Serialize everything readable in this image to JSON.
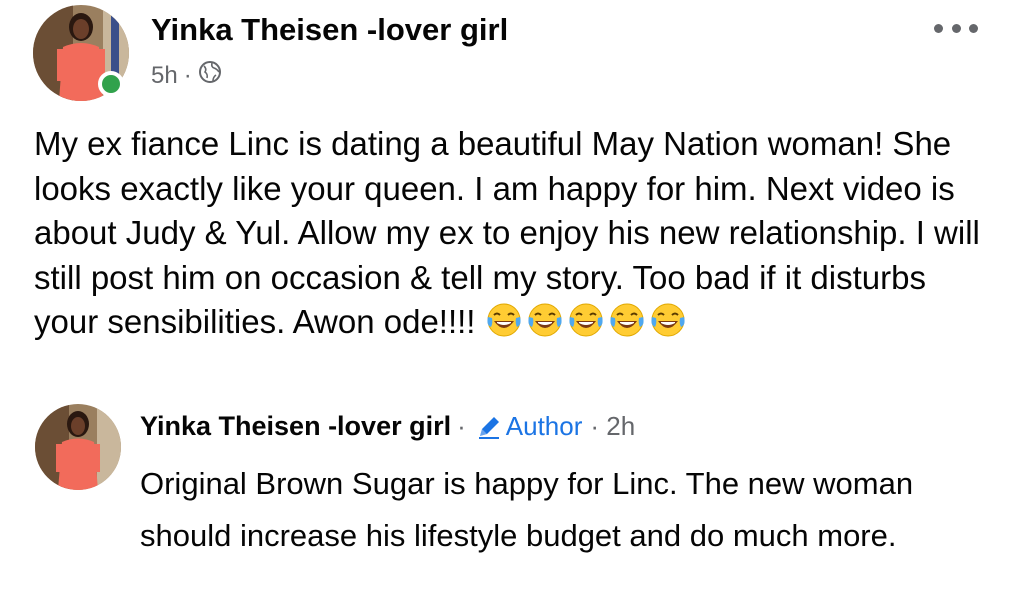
{
  "post": {
    "author": "Yinka Theisen -lover girl",
    "time": "5h",
    "separator": "·",
    "audience_icon": "globe-icon",
    "more_icon": "more-options-icon",
    "text": "My ex fiance Linc is dating a beautiful May Nation woman! She looks exactly like your queen. I am happy for him. Next video is about Judy & Yul. Allow my ex to enjoy his new relationship. I will still post him on occasion & tell my story. Too bad if it disturbs your sensibilities.  Awon ode!!!!",
    "emoji_icon": "tears-of-joy-emoji",
    "emoji_count": 5,
    "online_color": "#31a24c"
  },
  "comment": {
    "author": "Yinka Theisen -lover girl",
    "separator": "·",
    "badge_icon": "pencil-icon",
    "badge_label": "Author",
    "time_prefix": "· 2h",
    "text": "Original Brown Sugar is happy for Linc. The new woman should increase his lifestyle budget and do much more.",
    "accent_color": "#1b74e4"
  }
}
